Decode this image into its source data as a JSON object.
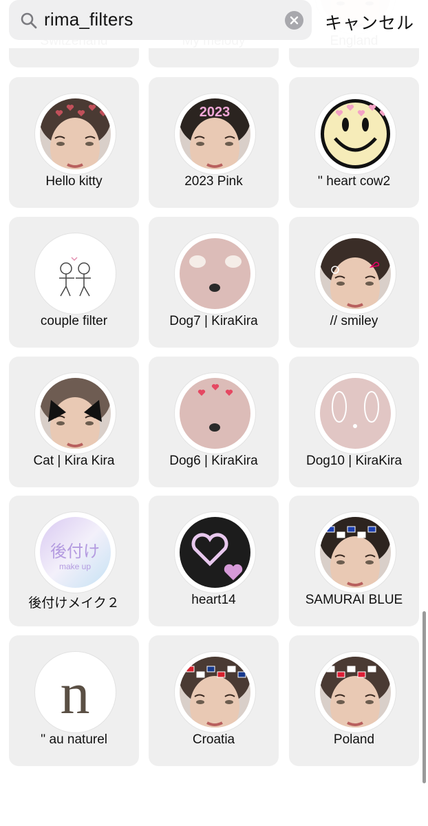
{
  "search": {
    "query": "rima_filters",
    "cancel_label": "キャンセル"
  },
  "colors": {
    "card_bg": "#efefef",
    "search_bg": "#efeff0",
    "clear_button": "#a8a8ad"
  },
  "filters": [
    {
      "label": "Switzerland",
      "icon": "face-hearts-icon"
    },
    {
      "label": "My melody",
      "icon": "face-portrait-icon"
    },
    {
      "label": "England",
      "icon": "face-flags-icon"
    },
    {
      "label": "Hello kitty",
      "icon": "face-kitty-icon"
    },
    {
      "label": "2023 Pink",
      "icon": "face-2023-icon"
    },
    {
      "label": "'' heart cow2",
      "icon": "smiley-hearts-icon"
    },
    {
      "label": "couple filter",
      "icon": "stick-figures-icon"
    },
    {
      "label": "Dog7 | KiraKira",
      "icon": "dog-face-icon"
    },
    {
      "label": "// smiley",
      "icon": "face-doodle-icon"
    },
    {
      "label": "Cat | Kira Kira",
      "icon": "cat-ears-icon"
    },
    {
      "label": "Dog6 | KiraKira",
      "icon": "dog-hearts-icon"
    },
    {
      "label": "Dog10 | KiraKira",
      "icon": "dog-ears-outline-icon"
    },
    {
      "label": "後付けメイク２",
      "icon": "makeup-text-icon",
      "logo_text": "後付け",
      "logo_sub": "make up"
    },
    {
      "label": "heart14",
      "icon": "heart-outline-icon"
    },
    {
      "label": "SAMURAI BLUE",
      "icon": "face-japan-flags-icon"
    },
    {
      "label": "'' au naturel",
      "icon": "letter-n-icon",
      "logo_text": "n"
    },
    {
      "label": "Croatia",
      "icon": "face-croatia-icon"
    },
    {
      "label": "Poland",
      "icon": "face-poland-icon"
    }
  ]
}
